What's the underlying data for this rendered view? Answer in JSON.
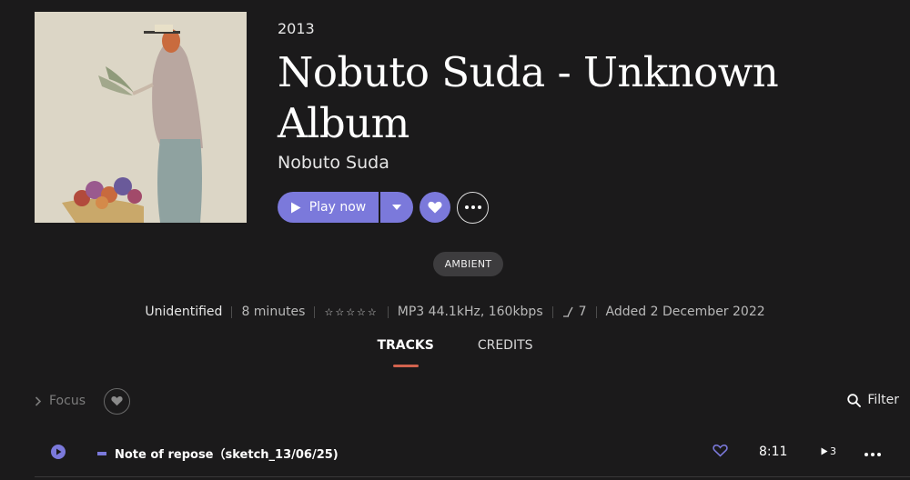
{
  "album": {
    "year": "2013",
    "title": "Nobuto Suda - Unknown Album",
    "artist": "Nobuto Suda"
  },
  "actions": {
    "play_label": "Play now"
  },
  "genre": "AMBIENT",
  "meta": {
    "source": "Unidentified",
    "duration": "8 minutes",
    "rating_stars": "☆☆☆☆☆",
    "format": "MP3 44.1kHz, 160kbps",
    "loudness": "7",
    "added": "Added 2 December 2022"
  },
  "tabs": [
    {
      "label": "TRACKS",
      "active": true
    },
    {
      "label": "CREDITS",
      "active": false
    }
  ],
  "toolbar": {
    "focus_label": "Focus",
    "filter_label": "Filter"
  },
  "tracks": [
    {
      "title": "Note of repose（sketch_13/06/25)",
      "duration": "8:11",
      "plays": "3"
    }
  ],
  "colors": {
    "accent": "#7b79db",
    "background": "#1b1a1b",
    "tab_underline": "#d2634e"
  },
  "icons": {
    "play": "play-icon",
    "caret": "chevron-down-icon",
    "heart": "heart-icon",
    "more": "more-icon",
    "search": "search-icon",
    "chevron_right": "chevron-right-icon",
    "loudness": "loudness-icon"
  }
}
